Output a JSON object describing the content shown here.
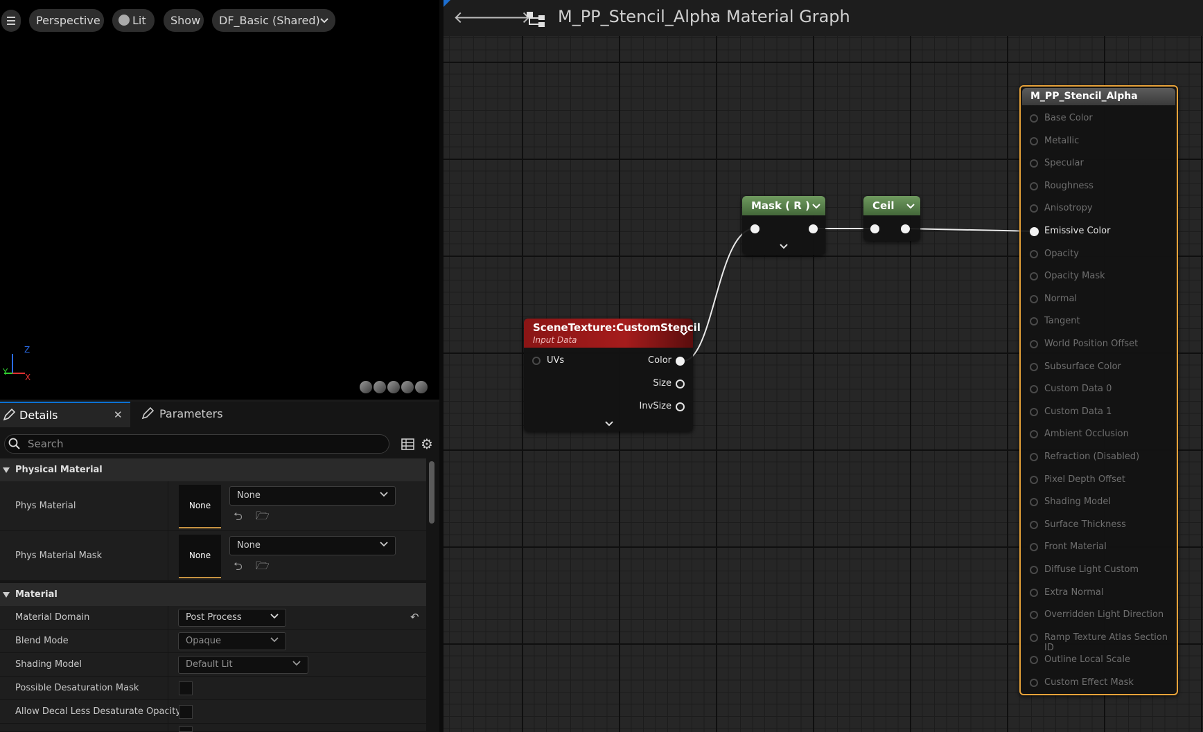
{
  "viewport": {
    "buttons": [
      "Perspective",
      "Lit",
      "Show",
      "DF_Basic (Shared)"
    ],
    "axes": {
      "z": "Z",
      "y": "Y",
      "x": "X"
    }
  },
  "details": {
    "tabs": [
      "Details",
      "Parameters"
    ],
    "search_placeholder": "Search",
    "categories": {
      "physical": "Physical Material",
      "material": "Material"
    },
    "rows": {
      "phys_material": "Phys Material",
      "phys_material_mask": "Phys Material Mask",
      "material_domain": "Material Domain",
      "blend_mode": "Blend Mode",
      "shading_model": "Shading Model",
      "possible_desaturation_mask": "Possible Desaturation Mask",
      "allow_decal": "Allow Decal Less Desaturate Opacity"
    },
    "values": {
      "phys_thumb": "None",
      "phys_dropdown": "None",
      "mask_thumb": "None",
      "mask_dropdown": "None",
      "material_domain": "Post Process",
      "blend_mode": "Opaque",
      "shading_model": "Default Lit"
    }
  },
  "graph": {
    "breadcrumb": [
      "M_PP_Stencil_Alpha",
      "Material Graph"
    ],
    "scene_node": {
      "title": "SceneTexture:CustomStencil",
      "subtitle": "Input Data",
      "input": "UVs",
      "outputs": [
        "Color",
        "Size",
        "InvSize"
      ]
    },
    "mask_node": {
      "title": "Mask ( R )"
    },
    "ceil_node": {
      "title": "Ceil"
    },
    "result_node": {
      "title": "M_PP_Stencil_Alpha",
      "inputs": [
        "Base Color",
        "Metallic",
        "Specular",
        "Roughness",
        "Anisotropy",
        "Emissive Color",
        "Opacity",
        "Opacity Mask",
        "Normal",
        "Tangent",
        "World Position Offset",
        "Subsurface Color",
        "Custom Data 0",
        "Custom Data 1",
        "Ambient Occlusion",
        "Refraction (Disabled)",
        "Pixel Depth Offset",
        "Shading Model",
        "Surface Thickness",
        "Front Material",
        "Diffuse Light Custom",
        "Extra Normal",
        "Overridden Light Direction",
        "Ramp Texture Atlas Section ID",
        "Outline Local Scale",
        "Custom Effect Mask"
      ],
      "active_input": "Emissive Color"
    }
  }
}
